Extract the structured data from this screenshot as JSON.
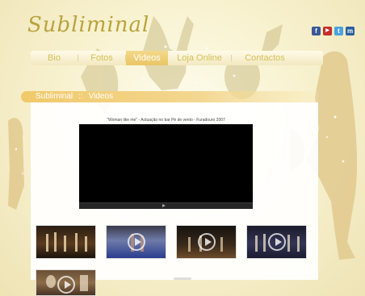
{
  "logo": {
    "text": "Subliminal"
  },
  "social": [
    {
      "name": "facebook-icon",
      "glyph": "f",
      "color": "#3b5998"
    },
    {
      "name": "youtube-icon",
      "glyph": "▶",
      "color": "#c4302b"
    },
    {
      "name": "twitter-icon",
      "glyph": "t",
      "color": "#4aa3df"
    },
    {
      "name": "myspace-icon",
      "glyph": "m",
      "color": "#2b5f9e"
    }
  ],
  "nav": {
    "items": [
      {
        "label": "Bio"
      },
      {
        "label": "Fotos"
      },
      {
        "label": "Videos"
      },
      {
        "label": "Loja Online"
      },
      {
        "label": "Contactos"
      }
    ],
    "active": "Videos"
  },
  "breadcrumb": {
    "site": "Subliminal",
    "separator": "::",
    "page": "Videos"
  },
  "video": {
    "caption": "\"Woman like me\" - Actuação no bar Pé de vento - Furadouro 2007"
  },
  "thumbnails": [
    {
      "name": "video-thumb-1",
      "has_play": false
    },
    {
      "name": "video-thumb-2",
      "has_play": true
    },
    {
      "name": "video-thumb-3",
      "has_play": true
    },
    {
      "name": "video-thumb-4",
      "has_play": true
    },
    {
      "name": "video-thumb-5",
      "has_play": true
    }
  ],
  "colors": {
    "accent": "#e9c565",
    "nav_text": "#d2bf5a",
    "logo": "#b8a33e"
  }
}
